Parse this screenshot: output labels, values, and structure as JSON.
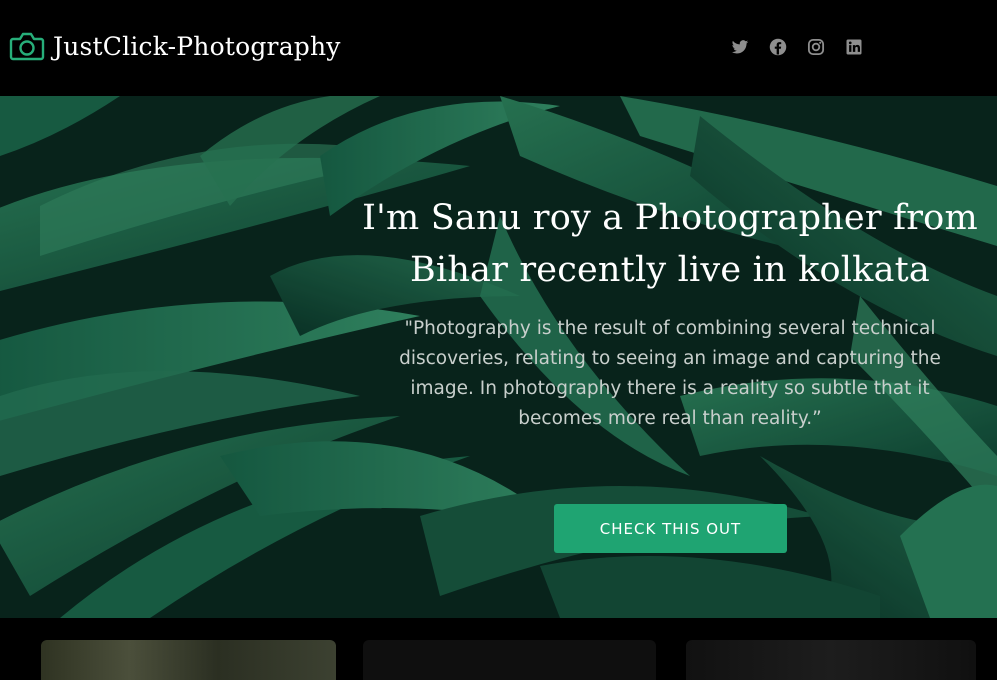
{
  "header": {
    "brand": "JustClick-Photography",
    "logo_icon": "camera-icon",
    "accent_color": "#27ae7a",
    "socials": [
      {
        "name": "twitter-icon"
      },
      {
        "name": "facebook-icon"
      },
      {
        "name": "instagram-icon"
      },
      {
        "name": "linkedin-icon"
      }
    ]
  },
  "hero": {
    "title": "I'm Sanu roy a Photographer from Bihar recently live in kolkata",
    "quote": "\"Photography is the result of combining several technical discoveries, relating to seeing an image and capturing the image. In photography there is a reality so subtle that it becomes more real than reality.”",
    "cta_label": "CHECK THIS OUT",
    "cta_color": "#1fa472"
  }
}
